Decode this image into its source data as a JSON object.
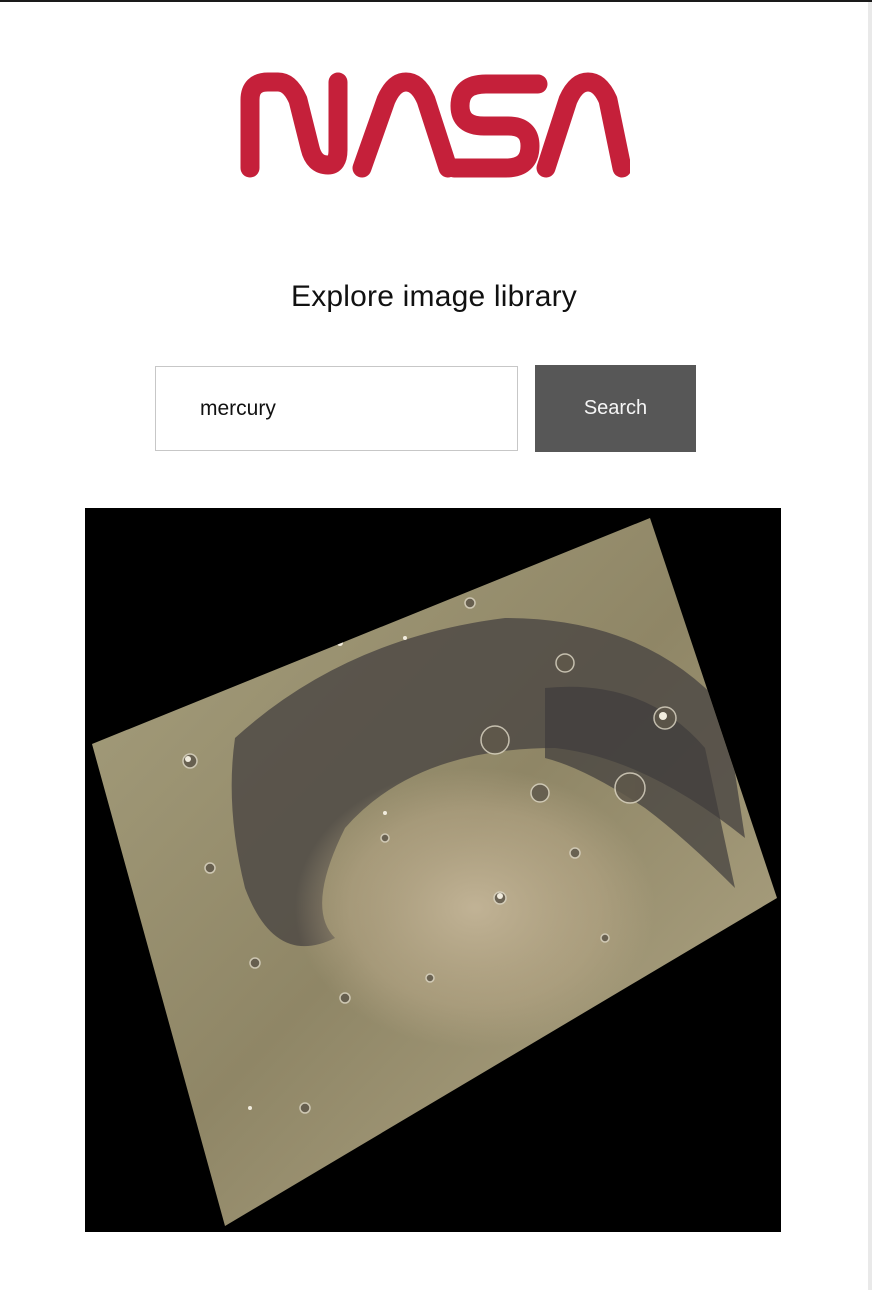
{
  "logo": {
    "text": "NASA",
    "color": "#c5203a"
  },
  "heading": "Explore image library",
  "search": {
    "value": "mercury",
    "button_label": "Search"
  },
  "result": {
    "image_subject": "mercury-surface-false-color-photo"
  },
  "colors": {
    "button_bg": "#575757",
    "image_bg": "#000000"
  }
}
